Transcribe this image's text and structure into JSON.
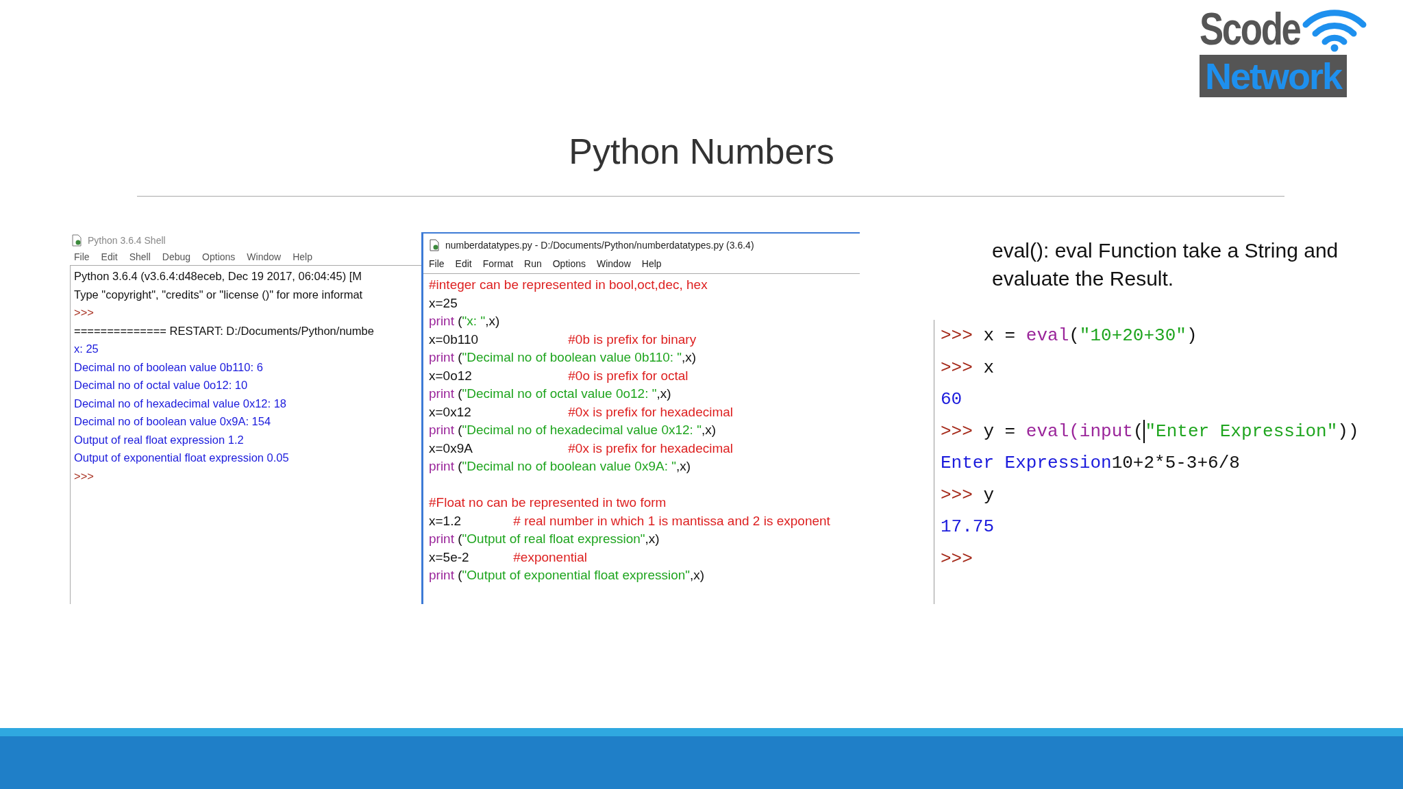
{
  "logo": {
    "top": "Scode",
    "bottom": "Network"
  },
  "title": "Python Numbers",
  "shell": {
    "title": "Python 3.6.4 Shell",
    "menu": [
      "File",
      "Edit",
      "Shell",
      "Debug",
      "Options",
      "Window",
      "Help"
    ],
    "lines": [
      [
        {
          "kind": "plain",
          "text": "Python 3.6.4 (v3.6.4:d48eceb, Dec 19 2017, 06:04:45)  [M"
        }
      ],
      [
        {
          "kind": "plain",
          "text": "Type \"copyright\", \"credits\" or \"license ()\" for more informat"
        }
      ],
      [
        {
          "kind": "prompt",
          "text": ">>>"
        }
      ],
      [
        {
          "kind": "plain",
          "text": "============== RESTART: D:/Documents/Python/numbe"
        }
      ],
      [
        {
          "kind": "output",
          "text": "x:  25"
        }
      ],
      [
        {
          "kind": "output",
          "text": "Decimal no of boolean value 0b110:  6"
        }
      ],
      [
        {
          "kind": "output",
          "text": "Decimal no of octal value 0o12:  10"
        }
      ],
      [
        {
          "kind": "output",
          "text": "Decimal no of hexadecimal value 0x12:  18"
        }
      ],
      [
        {
          "kind": "output",
          "text": "Decimal no of boolean value 0x9A:  154"
        }
      ],
      [
        {
          "kind": "output",
          "text": "Output of real float expression 1.2"
        }
      ],
      [
        {
          "kind": "output",
          "text": "Output of exponential float expression 0.05"
        }
      ],
      [
        {
          "kind": "prompt",
          "text": ">>>"
        }
      ]
    ]
  },
  "editor": {
    "title": "numberdatatypes.py - D:/Documents/Python/numberdatatypes.py (3.6.4)",
    "menu": [
      "File",
      "Edit",
      "Format",
      "Run",
      "Options",
      "Window",
      "Help"
    ],
    "blocks": [
      [
        {
          "comment": "#integer can be represented in bool,oct,dec, hex"
        },
        {
          "code": [
            {
              "kind": "plain",
              "text": "x=25"
            }
          ]
        },
        {
          "code": [
            {
              "kind": "builtin",
              "text": "print"
            },
            {
              "kind": "plain",
              "text": " ("
            },
            {
              "kind": "string",
              "text": "\"x: \""
            },
            {
              "kind": "plain",
              "text": ",x)"
            }
          ]
        },
        {
          "code": [
            {
              "kind": "plain",
              "text": "x=0b110"
            }
          ],
          "comment": "#0b is prefix for binary"
        },
        {
          "code": [
            {
              "kind": "builtin",
              "text": "print"
            },
            {
              "kind": "plain",
              "text": " ("
            },
            {
              "kind": "string",
              "text": "\"Decimal no of boolean value 0b110: \""
            },
            {
              "kind": "plain",
              "text": ",x)"
            }
          ]
        },
        {
          "code": [
            {
              "kind": "plain",
              "text": "x=0o12"
            }
          ],
          "comment": "#0o is prefix for octal"
        },
        {
          "code": [
            {
              "kind": "builtin",
              "text": "print"
            },
            {
              "kind": "plain",
              "text": " ("
            },
            {
              "kind": "string",
              "text": "\"Decimal no of octal value 0o12: \""
            },
            {
              "kind": "plain",
              "text": ",x)"
            }
          ]
        },
        {
          "code": [
            {
              "kind": "plain",
              "text": "x=0x12"
            }
          ],
          "comment": "#0x is prefix for hexadecimal"
        },
        {
          "code": [
            {
              "kind": "builtin",
              "text": "print"
            },
            {
              "kind": "plain",
              "text": " ("
            },
            {
              "kind": "string",
              "text": "\"Decimal no of hexadecimal value 0x12: \""
            },
            {
              "kind": "plain",
              "text": ",x)"
            }
          ]
        },
        {
          "code": [
            {
              "kind": "plain",
              "text": "x=0x9A"
            }
          ],
          "comment": "#0x is prefix for hexadecimal"
        },
        {
          "code": [
            {
              "kind": "builtin",
              "text": "print"
            },
            {
              "kind": "plain",
              "text": " ("
            },
            {
              "kind": "string",
              "text": "\"Decimal no of boolean value 0x9A: \""
            },
            {
              "kind": "plain",
              "text": ",x)"
            }
          ]
        }
      ],
      [
        {
          "comment": "#Float no can be represented in two form"
        },
        {
          "code": [
            {
              "kind": "plain",
              "text": "x=1.2"
            }
          ],
          "comment": "# real number in which 1 is mantissa and 2 is exponent"
        },
        {
          "code": [
            {
              "kind": "builtin",
              "text": "print"
            },
            {
              "kind": "plain",
              "text": " ("
            },
            {
              "kind": "string",
              "text": "\"Output of real float expression\""
            },
            {
              "kind": "plain",
              "text": ",x)"
            }
          ]
        },
        {
          "code": [
            {
              "kind": "plain",
              "text": "x=5e-2"
            }
          ],
          "comment": "#exponential"
        },
        {
          "code": [
            {
              "kind": "builtin",
              "text": "print"
            },
            {
              "kind": "plain",
              "text": " ("
            },
            {
              "kind": "string",
              "text": "\"Output of exponential float expression\""
            },
            {
              "kind": "plain",
              "text": ",x)"
            }
          ]
        }
      ]
    ]
  },
  "description": "eval():  eval Function take a String and evaluate the Result.",
  "console": [
    [
      {
        "kind": "prompt",
        "text": ">>>"
      },
      {
        "kind": "plain",
        "text": " x = "
      },
      {
        "kind": "builtin",
        "text": "eval"
      },
      {
        "kind": "plain",
        "text": "("
      },
      {
        "kind": "string",
        "text": "\"10+20+30\""
      },
      {
        "kind": "plain",
        "text": ")"
      }
    ],
    [
      {
        "kind": "prompt",
        "text": ">>>"
      },
      {
        "kind": "plain",
        "text": " x"
      }
    ],
    [
      {
        "kind": "output",
        "text": "60"
      }
    ],
    [
      {
        "kind": "prompt",
        "text": ">>>"
      },
      {
        "kind": "plain",
        "text": " y = "
      },
      {
        "kind": "builtin",
        "text": "eval(input"
      },
      {
        "kind": "plain",
        "text": "("
      },
      {
        "kind": "cursor"
      },
      {
        "kind": "string",
        "text": "\"Enter Expression\""
      },
      {
        "kind": "plain",
        "text": "))"
      }
    ],
    [
      {
        "kind": "output",
        "text": "Enter Expression"
      },
      {
        "kind": "plain",
        "text": "10+2*5-3+6/8"
      }
    ],
    [
      {
        "kind": "prompt",
        "text": ">>>"
      },
      {
        "kind": "plain",
        "text": " y"
      }
    ],
    [
      {
        "kind": "output",
        "text": "17.75"
      }
    ],
    [
      {
        "kind": "prompt",
        "text": ">>>"
      }
    ]
  ]
}
